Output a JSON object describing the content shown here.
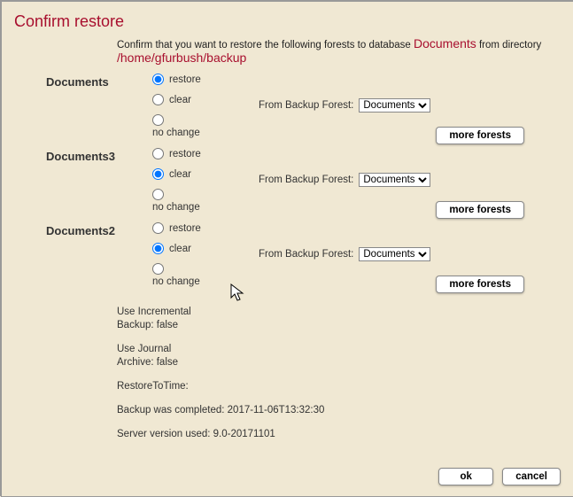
{
  "title": "Confirm restore",
  "intro": {
    "prefix": "Confirm that you want to restore the following forests to database ",
    "database": "Documents",
    "middle": " from directory ",
    "directory": "/home/gfurbush/backup"
  },
  "radio_labels": {
    "restore": "restore",
    "clear": "clear",
    "no_change": "no change"
  },
  "backup_label": "From Backup Forest:",
  "more_forests_label": "more forests",
  "forests": [
    {
      "name": "Documents",
      "selected": "restore",
      "backup_selected": "Documents"
    },
    {
      "name": "Documents3",
      "selected": "clear",
      "backup_selected": "Documents"
    },
    {
      "name": "Documents2",
      "selected": "clear",
      "backup_selected": "Documents"
    }
  ],
  "backup_options": [
    "Documents"
  ],
  "info": {
    "incremental_line1": "Use Incremental",
    "incremental_line2": "Backup: false",
    "journal_line1": "Use Journal",
    "journal_line2": "Archive: false",
    "restore_to_time": "RestoreToTime:",
    "backup_completed": "Backup was completed: 2017-11-06T13:32:30",
    "server_version": "Server version used: 9.0-20171101"
  },
  "buttons": {
    "ok": "ok",
    "cancel": "cancel"
  }
}
